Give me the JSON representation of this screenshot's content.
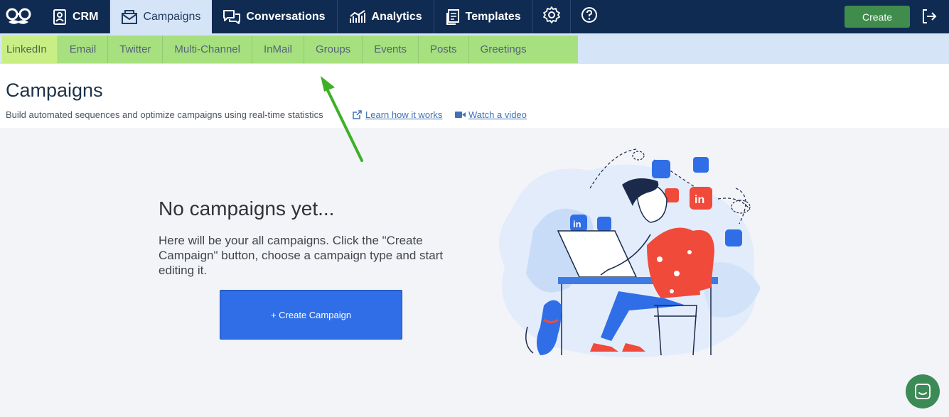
{
  "topnav": {
    "items": [
      {
        "label": "CRM",
        "icon": "contact-book-icon"
      },
      {
        "label": "Campaigns",
        "icon": "envelope-icon"
      },
      {
        "label": "Conversations",
        "icon": "chat-bubbles-icon"
      },
      {
        "label": "Analytics",
        "icon": "bar-chart-icon"
      },
      {
        "label": "Templates",
        "icon": "document-icon"
      }
    ],
    "create_label": "Create",
    "colors": {
      "bar": "#0f2b52",
      "active": "#d6e4f7",
      "create": "#3f8c4c"
    }
  },
  "subnav": {
    "tabs": [
      "LinkedIn",
      "Email",
      "Twitter",
      "Multi-Channel",
      "InMail",
      "Groups",
      "Events",
      "Posts",
      "Greetings"
    ],
    "active": "LinkedIn",
    "highlight_color": "#a6e07f"
  },
  "header": {
    "title": "Campaigns",
    "subtitle": "Build automated sequences and optimize campaigns using real-time statistics",
    "link_learn": "Learn how it works",
    "link_video": "Watch a video"
  },
  "empty_state": {
    "title": "No campaigns yet...",
    "description": "Here will be your all campaigns. Click the \"Create Campaign\" button, choose a campaign type and start editing it.",
    "cta_label": "+ Create Campaign"
  }
}
